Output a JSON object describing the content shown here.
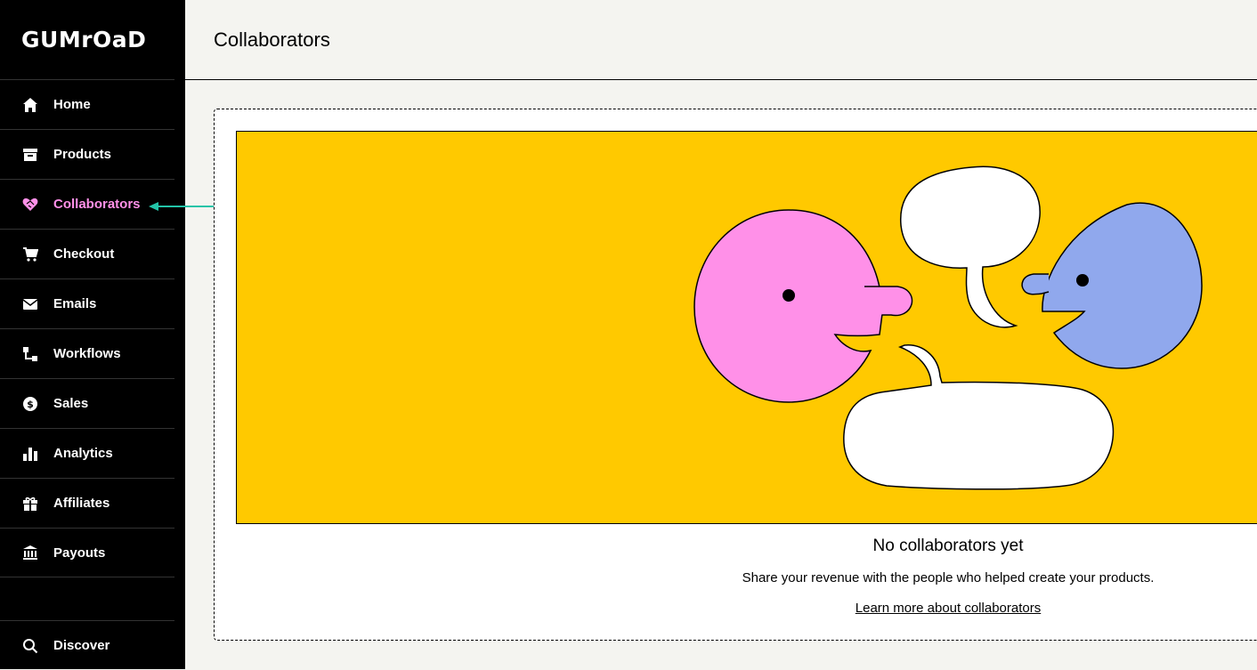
{
  "brand": {
    "logo_text": "GUMrOaD"
  },
  "sidebar": {
    "items": [
      {
        "label": "Home",
        "icon": "home-icon"
      },
      {
        "label": "Products",
        "icon": "archive-icon"
      },
      {
        "label": "Collaborators",
        "icon": "handshake-heart-icon",
        "active": true
      },
      {
        "label": "Checkout",
        "icon": "cart-icon"
      },
      {
        "label": "Emails",
        "icon": "envelope-icon"
      },
      {
        "label": "Workflows",
        "icon": "workflow-icon"
      },
      {
        "label": "Sales",
        "icon": "dollar-circle-icon"
      },
      {
        "label": "Analytics",
        "icon": "bar-chart-icon"
      },
      {
        "label": "Affiliates",
        "icon": "gift-icon"
      },
      {
        "label": "Payouts",
        "icon": "bank-icon"
      }
    ],
    "bottom": {
      "label": "Discover",
      "icon": "search-icon"
    }
  },
  "header": {
    "title": "Collaborators"
  },
  "empty_state": {
    "title": "No collaborators yet",
    "description": "Share your revenue with the people who helped create your products.",
    "link": "Learn more about collaborators"
  },
  "colors": {
    "sidebar_bg": "#000000",
    "active_accent": "#ff90e8",
    "illustration_bg": "#ffc900",
    "pink_head": "#ff90e8",
    "blue_head": "#90a8ed",
    "annotation_arrow": "#23c4a8"
  }
}
